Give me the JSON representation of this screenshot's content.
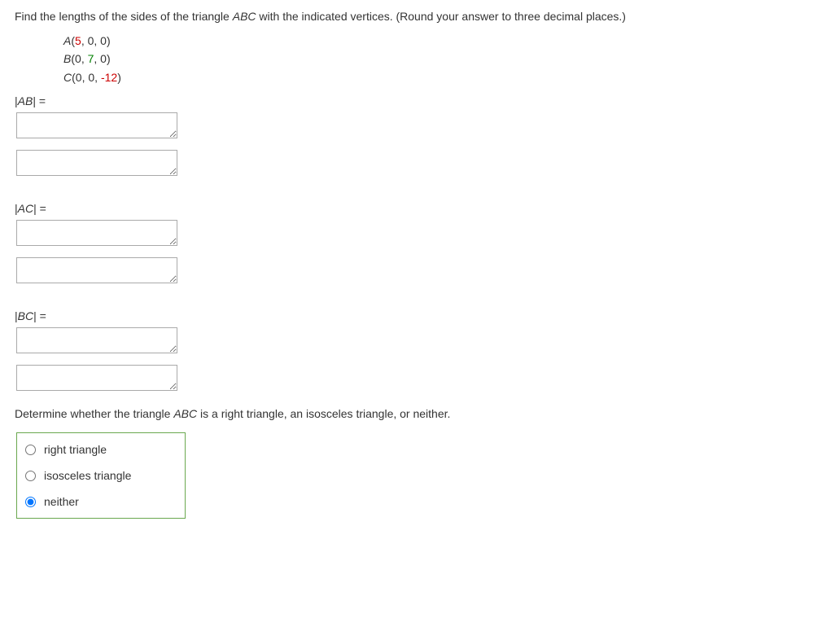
{
  "question": {
    "prompt_prefix": "Find the lengths of the sides of the triangle ",
    "prompt_abc": "ABC",
    "prompt_suffix": " with the indicated vertices. (Round your answer to three decimal places.)"
  },
  "vertices": {
    "A": {
      "label": "A",
      "p1": "5",
      "p2": "0",
      "p3": "0",
      "open": "(",
      "close": ")"
    },
    "B": {
      "label": "B",
      "p1": "0",
      "p2": "7",
      "p3": "0",
      "open": "(",
      "close": ")"
    },
    "C": {
      "label": "C",
      "p1": "0",
      "p2": "0",
      "p3": "-12",
      "open": "(",
      "close": ")"
    }
  },
  "sides": {
    "ab": {
      "bar1": "|",
      "var": "AB",
      "bar2": "|",
      "eq": " = ",
      "val1": "",
      "val2": ""
    },
    "ac": {
      "bar1": "|",
      "var": "AC",
      "bar2": "|",
      "eq": " = ",
      "val1": "",
      "val2": ""
    },
    "bc": {
      "bar1": "|",
      "var": "BC",
      "bar2": "|",
      "eq": " = ",
      "val1": "",
      "val2": ""
    }
  },
  "determine": {
    "prefix": "Determine whether the triangle ",
    "abc": "ABC",
    "suffix": " is a right triangle, an isosceles triangle, or neither."
  },
  "options": {
    "right": "right triangle",
    "isosceles": "isosceles triangle",
    "neither": "neither"
  },
  "selected": "neither"
}
